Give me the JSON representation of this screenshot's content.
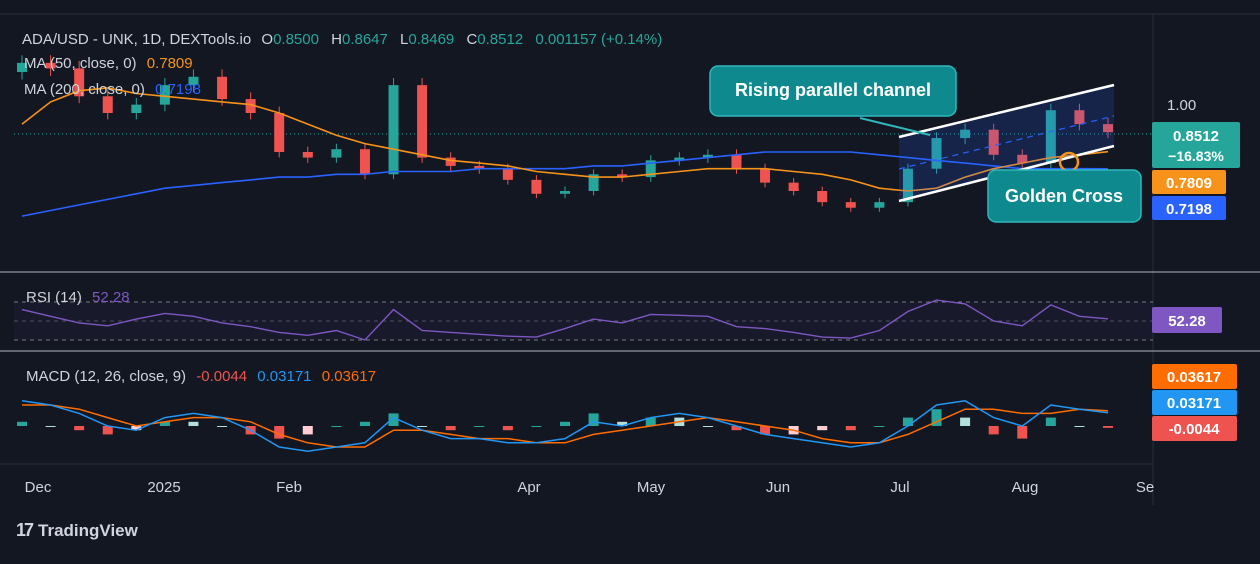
{
  "header": {
    "symbol": "ADA/USD - UNK, 1D, DEXTools.io",
    "o_label": "O",
    "o_value": "0.8500",
    "h_label": "H",
    "h_value": "0.8647",
    "l_label": "L",
    "l_value": "0.8469",
    "c_label": "C",
    "c_value": "0.8512",
    "change": "0.001157 (+0.14%)"
  },
  "ma50": {
    "label": "MA (50, close, 0)",
    "value": "0.7809",
    "color": "#f7931a"
  },
  "ma200": {
    "label": "MA (200, close, 0)",
    "value": "0.7198",
    "color": "#2962ff"
  },
  "rsi": {
    "label": "RSI (14)",
    "value": "52.28",
    "color": "#7e57c2"
  },
  "macd": {
    "label": "MACD (12, 26, close, 9)",
    "hist": "-0.0044",
    "macd_line": "0.03171",
    "signal": "0.03617"
  },
  "price_axis": {
    "level_label": "1.00",
    "last_price": "0.8512",
    "last_change": "−16.83%",
    "ma50_tag": "0.7809",
    "ma200_tag": "0.7198"
  },
  "rsi_tag": "52.28",
  "macd_tags": {
    "signal": "0.03617",
    "macd_line": "0.03171",
    "hist": "-0.0044"
  },
  "x_axis": [
    "Dec",
    "2025",
    "Feb",
    "Apr",
    "May",
    "Jun",
    "Jul",
    "Aug",
    "Se"
  ],
  "annotations": {
    "channel": "Rising parallel channel",
    "golden_cross": "Golden Cross"
  },
  "brand": "TradingView",
  "colors": {
    "background": "#131722",
    "up": "#26a69a",
    "down": "#ef5350",
    "callout": "#0e8a8e",
    "ma50": "#f7931a",
    "ma200": "#2962ff",
    "rsi": "#7e57c2",
    "macd_line": "#2196f3",
    "signal_line": "#ff6d00"
  },
  "chart_data": {
    "type": "candlestick",
    "title": "ADA/USD - UNK, 1D, DEXTools.io",
    "x": [
      "2024-12-01",
      "2024-12-08",
      "2024-12-15",
      "2024-12-22",
      "2024-12-29",
      "2025-01-05",
      "2025-01-12",
      "2025-01-19",
      "2025-01-26",
      "2025-02-02",
      "2025-02-09",
      "2025-02-16",
      "2025-02-23",
      "2025-03-02",
      "2025-03-09",
      "2025-03-16",
      "2025-03-23",
      "2025-03-30",
      "2025-04-06",
      "2025-04-13",
      "2025-04-20",
      "2025-04-27",
      "2025-05-04",
      "2025-05-11",
      "2025-05-18",
      "2025-05-25",
      "2025-06-01",
      "2025-06-08",
      "2025-06-15",
      "2025-06-22",
      "2025-06-29",
      "2025-07-06",
      "2025-07-13",
      "2025-07-20",
      "2025-07-27",
      "2025-08-03",
      "2025-08-10",
      "2025-08-17",
      "2025-08-21"
    ],
    "close": [
      1.1,
      1.08,
      0.98,
      0.92,
      0.95,
      1.02,
      1.05,
      0.97,
      0.92,
      0.78,
      0.76,
      0.79,
      0.7,
      1.02,
      0.76,
      0.73,
      0.72,
      0.68,
      0.63,
      0.64,
      0.7,
      0.69,
      0.75,
      0.76,
      0.77,
      0.72,
      0.67,
      0.64,
      0.6,
      0.58,
      0.6,
      0.72,
      0.83,
      0.86,
      0.77,
      0.74,
      0.93,
      0.88,
      0.8512
    ],
    "ma50": [
      0.88,
      0.96,
      1.0,
      1.01,
      0.99,
      0.98,
      0.97,
      0.96,
      0.95,
      0.92,
      0.88,
      0.84,
      0.81,
      0.79,
      0.77,
      0.75,
      0.74,
      0.73,
      0.71,
      0.7,
      0.69,
      0.69,
      0.7,
      0.71,
      0.72,
      0.72,
      0.72,
      0.71,
      0.7,
      0.68,
      0.65,
      0.64,
      0.65,
      0.69,
      0.72,
      0.74,
      0.76,
      0.77,
      0.7809
    ],
    "ma200": [
      0.55,
      0.57,
      0.59,
      0.61,
      0.63,
      0.65,
      0.66,
      0.67,
      0.68,
      0.69,
      0.69,
      0.7,
      0.7,
      0.71,
      0.71,
      0.71,
      0.72,
      0.72,
      0.72,
      0.72,
      0.73,
      0.73,
      0.74,
      0.75,
      0.76,
      0.77,
      0.78,
      0.78,
      0.78,
      0.78,
      0.77,
      0.76,
      0.75,
      0.74,
      0.73,
      0.72,
      0.72,
      0.72,
      0.7198
    ],
    "rsi": [
      62,
      55,
      48,
      45,
      52,
      58,
      55,
      48,
      44,
      38,
      35,
      40,
      30,
      62,
      40,
      38,
      36,
      34,
      33,
      42,
      52,
      48,
      57,
      56,
      55,
      44,
      42,
      38,
      33,
      32,
      40,
      60,
      72,
      68,
      50,
      45,
      67,
      55,
      52.28
    ],
    "macd_line": [
      0.06,
      0.05,
      0.03,
      0.0,
      -0.01,
      0.02,
      0.03,
      0.02,
      -0.01,
      -0.05,
      -0.06,
      -0.05,
      -0.04,
      0.02,
      -0.01,
      -0.03,
      -0.03,
      -0.04,
      -0.04,
      -0.03,
      0.01,
      0.0,
      0.02,
      0.03,
      0.02,
      0.0,
      -0.02,
      -0.03,
      -0.04,
      -0.05,
      -0.04,
      0.0,
      0.05,
      0.06,
      0.02,
      0.0,
      0.05,
      0.04,
      0.03171
    ],
    "signal_line": [
      0.05,
      0.05,
      0.04,
      0.02,
      0.0,
      0.01,
      0.02,
      0.02,
      0.01,
      -0.02,
      -0.04,
      -0.05,
      -0.05,
      -0.01,
      -0.01,
      -0.02,
      -0.03,
      -0.03,
      -0.04,
      -0.04,
      -0.02,
      -0.01,
      0.0,
      0.01,
      0.02,
      0.01,
      0.0,
      -0.01,
      -0.03,
      -0.04,
      -0.04,
      -0.02,
      0.01,
      0.04,
      0.04,
      0.03,
      0.03,
      0.04,
      0.03617
    ],
    "ylim": [
      0.5,
      1.2
    ],
    "grid": false,
    "legend": "top-left"
  }
}
